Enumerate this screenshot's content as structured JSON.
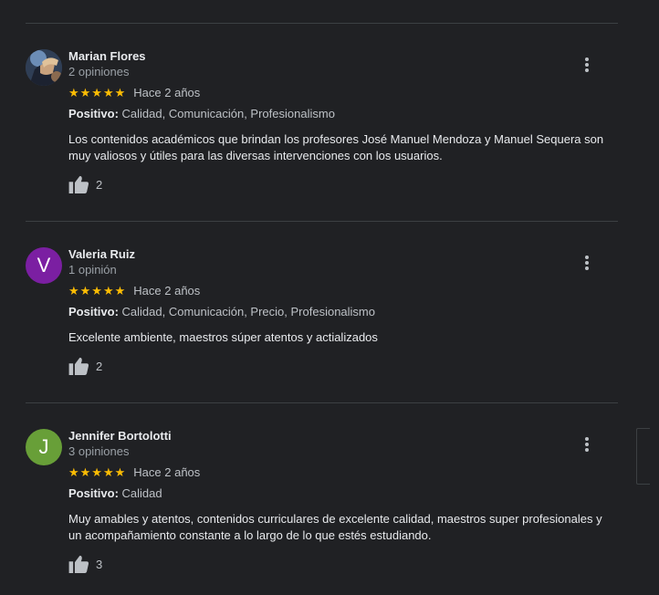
{
  "reviews": [
    {
      "name": "Marian Flores",
      "count": "2 opiniones",
      "stars": "★★★★★",
      "time": "Hace 2 años",
      "positive_label": "Positivo:",
      "positive_items": "Calidad, Comunicación, Profesionalismo",
      "text": "Los contenidos académicos que brindan los profesores José Manuel Mendoza y Manuel Sequera son muy valiosos y útiles para las diversas intervenciones con los usuarios.",
      "likes": "2",
      "avatar_type": "photo"
    },
    {
      "name": "Valeria Ruiz",
      "count": "1 opinión",
      "stars": "★★★★★",
      "time": "Hace 2 años",
      "positive_label": "Positivo:",
      "positive_items": "Calidad, Comunicación, Precio, Profesionalismo",
      "text": "Excelente ambiente, maestros súper atentos y actializados",
      "likes": "2",
      "avatar_letter": "V",
      "avatar_color": "#7b1fa2"
    },
    {
      "name": "Jennifer Bortolotti",
      "count": "3 opiniones",
      "stars": "★★★★★",
      "time": "Hace 2 años",
      "positive_label": "Positivo:",
      "positive_items": "Calidad",
      "text": "Muy amables y atentos, contenidos curriculares de excelente calidad, maestros super profesionales y un acompañamiento constante a lo largo de lo que estés estudiando.",
      "likes": "3",
      "avatar_letter": "J",
      "avatar_color": "#689f38"
    }
  ],
  "icons": {
    "menu": "more-vert-icon",
    "like": "thumb-up-icon",
    "star": "star-icon"
  },
  "colors": {
    "background": "#202124",
    "star": "#fbbc04",
    "divider": "#3c4043"
  }
}
